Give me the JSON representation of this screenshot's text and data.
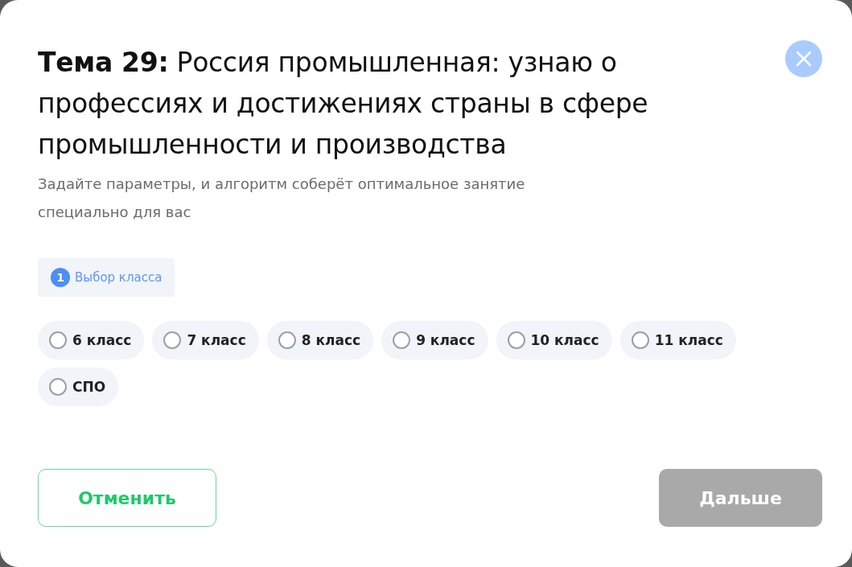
{
  "dialog": {
    "title": "**Тема 29:** Россия промышленная: узнаю о профессиях и достижениях страны в сфере промышленности и производства",
    "subtitle": "Задайте параметры, и алгоритм соберёт оптимальное занятие специально для вас"
  },
  "step": {
    "number": "1",
    "label": "Выбор класса"
  },
  "options": [
    {
      "label": "6 класс",
      "selected": false
    },
    {
      "label": "7 класс",
      "selected": false
    },
    {
      "label": "8 класс",
      "selected": false
    },
    {
      "label": "9 класс",
      "selected": false
    },
    {
      "label": "10 класс",
      "selected": false
    },
    {
      "label": "11 класс",
      "selected": false
    },
    {
      "label": "СПО",
      "selected": false
    }
  ],
  "buttons": {
    "cancel": {
      "label": "Отменить"
    },
    "next": {
      "label": "Дальше",
      "disabled": true
    }
  }
}
